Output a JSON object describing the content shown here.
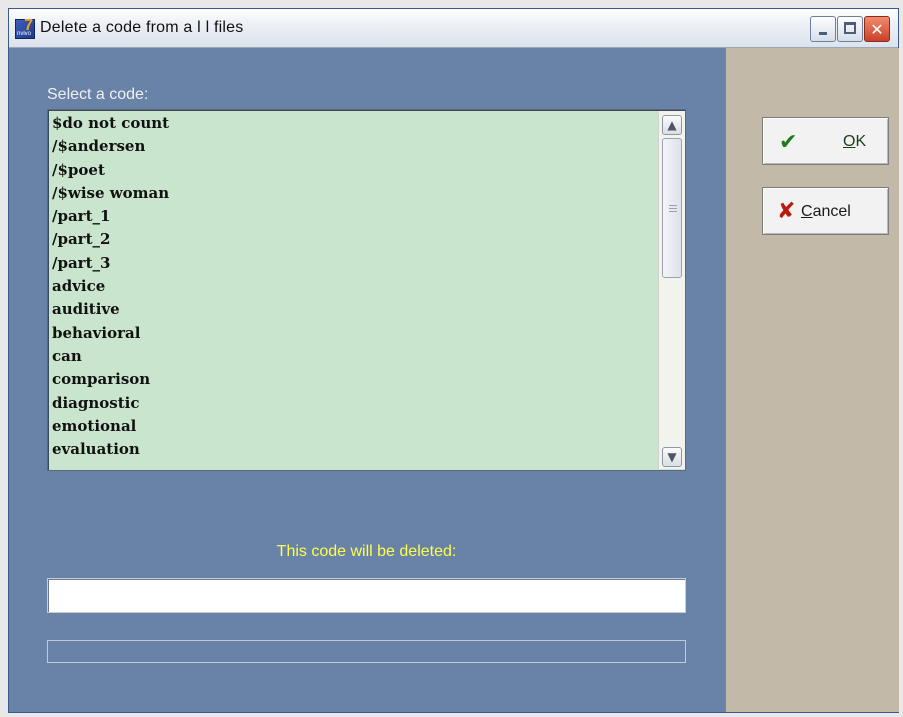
{
  "window": {
    "title": "Delete a code from a l l files",
    "app_icon": {
      "glyph": "7",
      "caption": "nvivo"
    },
    "controls": {
      "minimize": "minimize-icon",
      "maximize": "maximize-icon",
      "close": "close-icon"
    }
  },
  "form": {
    "select_label": "Select a code:",
    "codes": [
      "$do not count",
      "/$andersen",
      "/$poet",
      "/$wise woman",
      "/part_1",
      "/part_2",
      "/part_3",
      "advice",
      "auditive",
      "behavioral",
      "can",
      "comparison",
      "diagnostic",
      "emotional",
      "evaluation"
    ],
    "delete_caption": "This code will be deleted:",
    "selected_code_value": "",
    "progress_value": 0
  },
  "buttons": {
    "ok": {
      "label_first": "O",
      "label_rest": "K",
      "icon": "checkmark-icon"
    },
    "cancel": {
      "label_first": "C",
      "label_rest": "ancel",
      "icon": "x-icon"
    }
  },
  "colors": {
    "dialog_background": "#6882a8",
    "list_background": "#c9e5cd",
    "side_panel": "#c2b9a8",
    "caption_text": "#ffff4a"
  }
}
